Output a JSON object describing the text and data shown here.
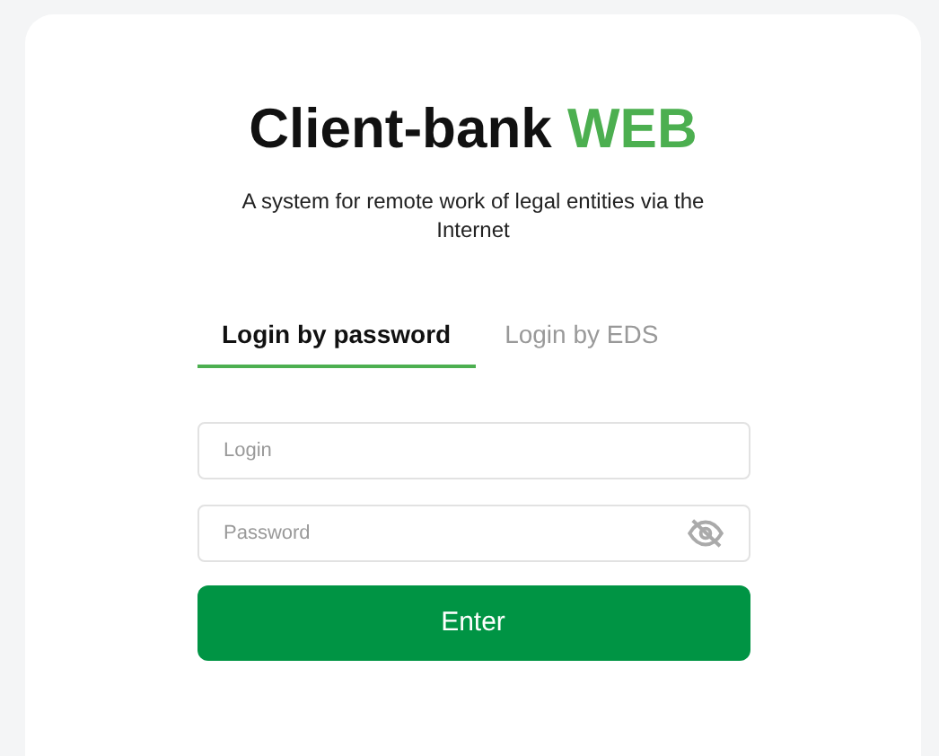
{
  "title": {
    "text": "Client-bank",
    "accent": "WEB"
  },
  "subtitle": "A system for remote work of legal entities via the Internet",
  "tabs": [
    {
      "label": "Login by password",
      "selected": true
    },
    {
      "label": "Login by EDS",
      "selected": false
    }
  ],
  "login": {
    "placeholder": "Login"
  },
  "password": {
    "placeholder": "Password"
  },
  "submit": "Enter"
}
